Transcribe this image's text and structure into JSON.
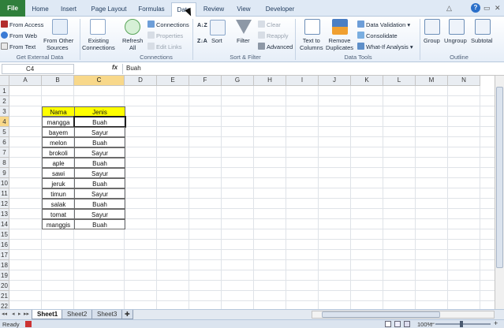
{
  "ribbon_tabs": [
    "File",
    "Home",
    "Insert",
    "Page Layout",
    "Formulas",
    "Data",
    "Review",
    "View",
    "Developer"
  ],
  "active_tab": "Data",
  "ribbon": {
    "get_external": {
      "from_access": "From Access",
      "from_web": "From Web",
      "from_text": "From Text",
      "from_other_1": "From Other",
      "from_other_2": "Sources",
      "label": "Get External Data"
    },
    "connections": {
      "existing_1": "Existing",
      "existing_2": "Connections",
      "refresh_1": "Refresh",
      "refresh_2": "All",
      "connections": "Connections",
      "properties": "Properties",
      "edit_links": "Edit Links",
      "label": "Connections"
    },
    "sort_filter": {
      "sort": "Sort",
      "filter": "Filter",
      "clear": "Clear",
      "reapply": "Reapply",
      "advanced": "Advanced",
      "label": "Sort & Filter",
      "az": "A↓Z",
      "za": "Z↓A"
    },
    "data_tools": {
      "text_to_columns_1": "Text to",
      "text_to_columns_2": "Columns",
      "remove_dup_1": "Remove",
      "remove_dup_2": "Duplicates",
      "data_validation": "Data Validation",
      "consolidate": "Consolidate",
      "what_if": "What-If Analysis",
      "label": "Data Tools"
    },
    "outline": {
      "group": "Group",
      "ungroup": "Ungroup",
      "subtotal": "Subtotal",
      "label": "Outline"
    }
  },
  "formula_bar": {
    "name_box": "C4",
    "fx": "fx",
    "content": "Buah"
  },
  "columns": [
    "A",
    "B",
    "C",
    "D",
    "E",
    "F",
    "G",
    "H",
    "I",
    "J",
    "K",
    "L",
    "M",
    "N"
  ],
  "rows": [
    "1",
    "2",
    "3",
    "4",
    "5",
    "6",
    "7",
    "8",
    "9",
    "10",
    "11",
    "12",
    "13",
    "14",
    "15",
    "16",
    "17",
    "18",
    "19",
    "20",
    "21",
    "22"
  ],
  "table": {
    "headers": [
      "Nama",
      "Jenis"
    ],
    "rows": [
      [
        "mangga",
        "Buah"
      ],
      [
        "bayem",
        "Sayur"
      ],
      [
        "melon",
        "Buah"
      ],
      [
        "brokoli",
        "Sayur"
      ],
      [
        "aple",
        "Buah"
      ],
      [
        "sawi",
        "Sayur"
      ],
      [
        "jeruk",
        "Buah"
      ],
      [
        "timun",
        "Sayur"
      ],
      [
        "salak",
        "Buah"
      ],
      [
        "tomat",
        "Sayur"
      ],
      [
        "manggis",
        "Buah"
      ]
    ]
  },
  "sheets": [
    "Sheet1",
    "Sheet2",
    "Sheet3"
  ],
  "active_sheet": "Sheet1",
  "status": {
    "ready": "Ready",
    "zoom": "100%"
  },
  "colors": {
    "file_tab": "#2f7f3b",
    "header_fill": "#ffff00",
    "selected_header": "#f8d88a"
  }
}
